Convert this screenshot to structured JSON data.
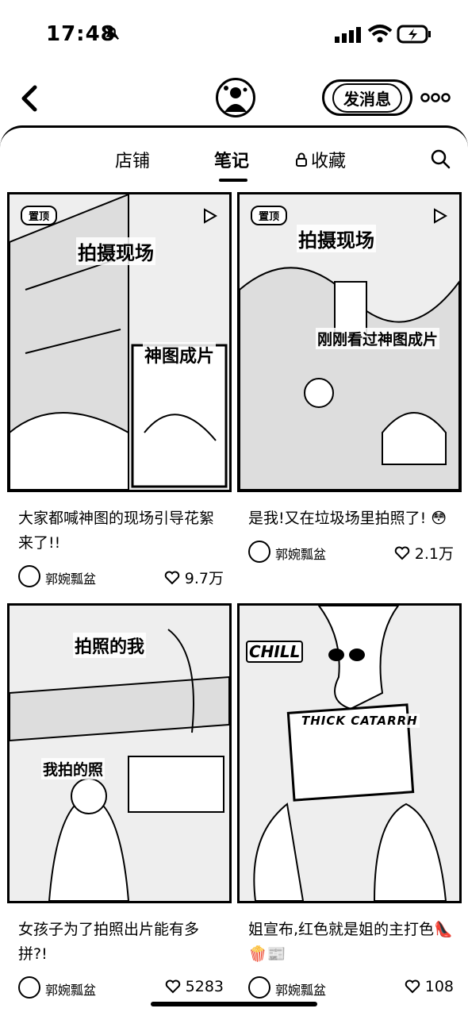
{
  "status": {
    "time": "17:48"
  },
  "header": {
    "message_button": "发消息"
  },
  "tabs": {
    "shop": "店铺",
    "notes": "笔记",
    "favorites": "收藏"
  },
  "cards": [
    {
      "pinned": "置顶",
      "overlay1": "拍摄现场",
      "overlay2": "神图成片",
      "overlay3": "",
      "title": "大家都喊神图的现场引导花絮来了!!",
      "author": "郭婉瓢盆",
      "likes": "9.7万"
    },
    {
      "pinned": "置顶",
      "overlay1": "拍摄现场",
      "overlay2": "刚刚看过神图成片",
      "overlay3": "",
      "title": "是我!又在垃圾场里拍照了! 😳",
      "author": "郭婉瓢盆",
      "likes": "2.1万"
    },
    {
      "pinned": "",
      "overlay1": "拍照的我",
      "overlay2": "我拍的照",
      "overlay3": "",
      "title": "女孩子为了拍照出片能有多拼?!",
      "author": "郭婉瓢盆",
      "likes": "5283"
    },
    {
      "pinned": "",
      "overlay1": "CHILL",
      "overlay2": "THICK CATARRH",
      "overlay3": "",
      "title": "姐宣布,红色就是姐的主打色👠🍿📰",
      "author": "郭婉瓢盆",
      "likes": "108"
    }
  ]
}
